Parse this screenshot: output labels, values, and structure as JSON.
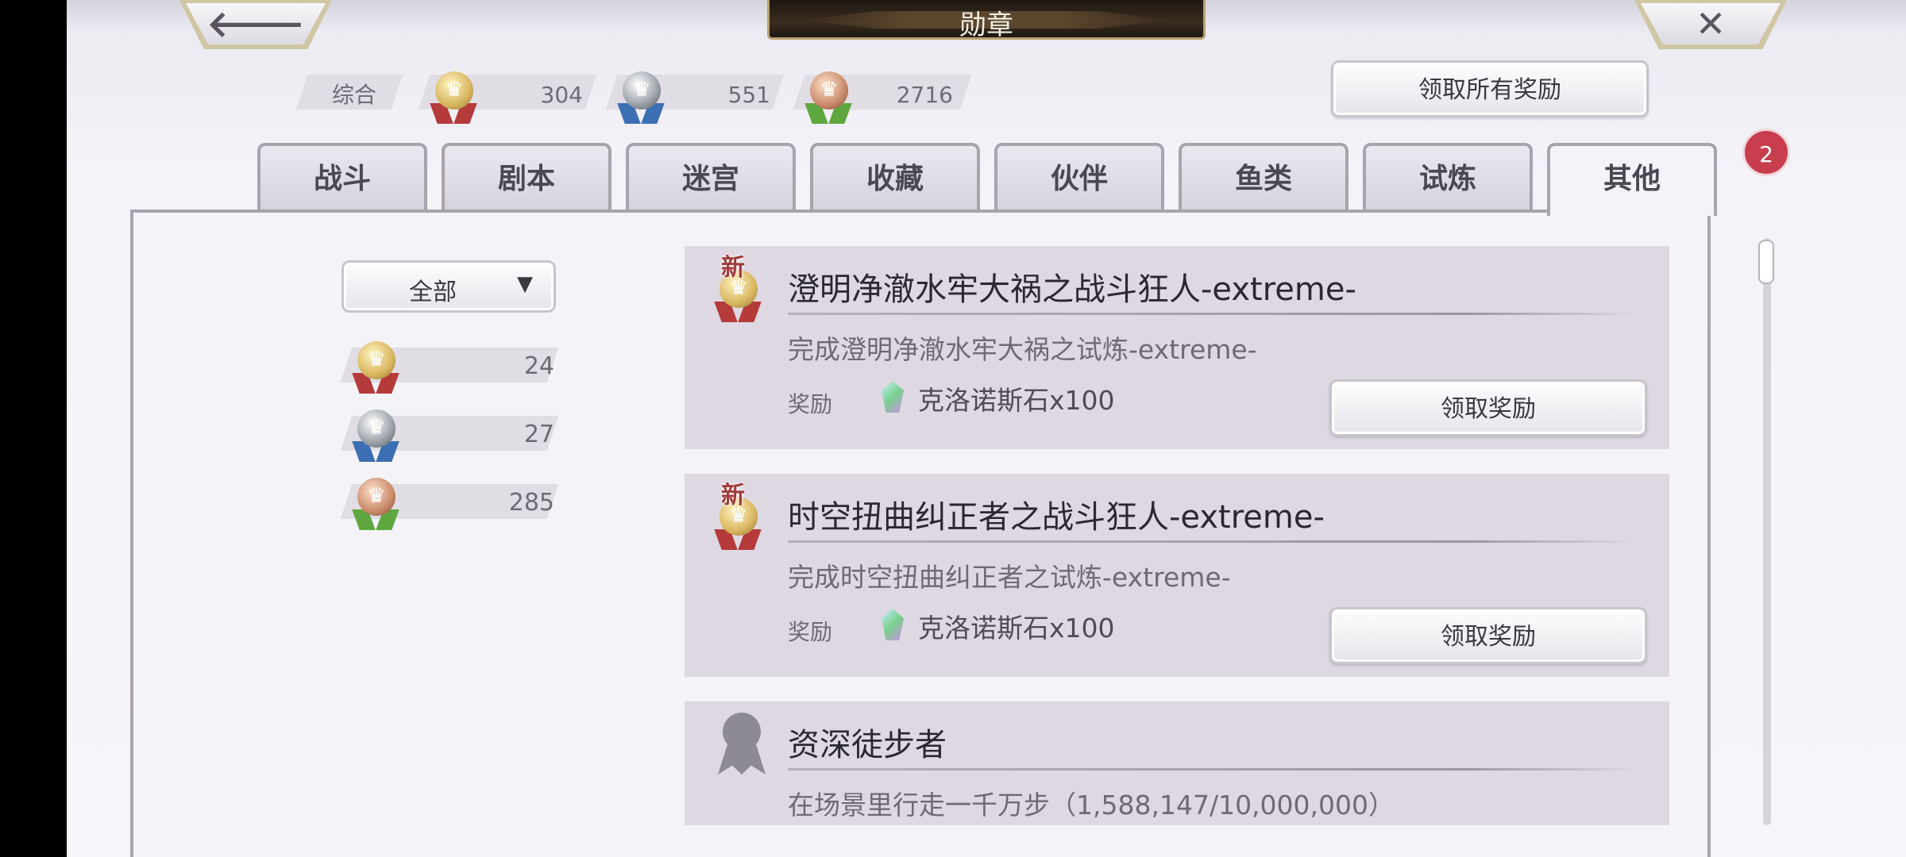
{
  "title": "勋章",
  "nav": {
    "back_glyph": "🡐",
    "close_glyph": "✕"
  },
  "summary": {
    "label": "综合",
    "gold": "304",
    "silver": "551",
    "bronze": "2716",
    "claim_all": "领取所有奖励"
  },
  "tabs": [
    {
      "label": "战斗"
    },
    {
      "label": "剧本"
    },
    {
      "label": "迷宫"
    },
    {
      "label": "收藏"
    },
    {
      "label": "伙伴"
    },
    {
      "label": "鱼类"
    },
    {
      "label": "试炼"
    },
    {
      "label": "其他"
    }
  ],
  "active_tab_badge": "2",
  "filter": {
    "selected": "全部",
    "arrow": "▼",
    "gold_count": "24",
    "silver_count": "27",
    "bronze_count": "285"
  },
  "cards": [
    {
      "new_label": "新",
      "title": "澄明净澈水牢大祸之战斗狂人-extreme-",
      "desc": "完成澄明净澈水牢大祸之试炼-extreme-",
      "reward_label": "奖励",
      "reward": "克洛诺斯石x100",
      "button": "领取奖励"
    },
    {
      "new_label": "新",
      "title": "时空扭曲纠正者之战斗狂人-extreme-",
      "desc": "完成时空扭曲纠正者之试炼-extreme-",
      "reward_label": "奖励",
      "reward": "克洛诺斯石x100",
      "button": "领取奖励"
    },
    {
      "title": "资深徒步者",
      "desc": "在场景里行走一千万步（1,588,147/10,000,000）"
    }
  ],
  "colors": {
    "badge": "#c83e4e",
    "title_bar": "#2a2018",
    "ribbon_gold": "#b53a3a",
    "ribbon_silver": "#3c6fb4",
    "ribbon_bronze": "#5ea63e"
  }
}
